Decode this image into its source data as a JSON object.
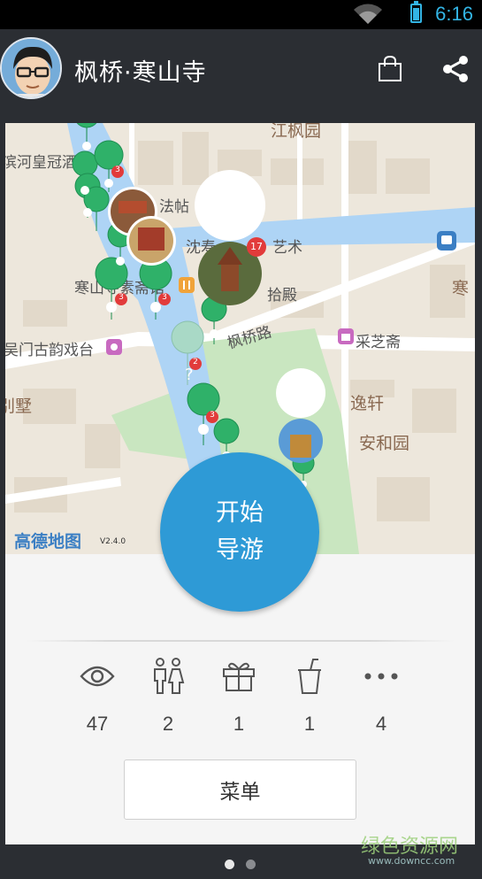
{
  "status": {
    "time": "6:16"
  },
  "appbar": {
    "title": "枫桥·寒山寺"
  },
  "map": {
    "labels": {
      "binhe_hotel": "滨河皇冠酒店",
      "jiangfengyuan": "江枫园",
      "fatie": "法帖",
      "shenshou": "沈寿",
      "yishu": "艺术",
      "hanshan_vegetarian": "寒山寺素斋馆",
      "shidian": "拾殿",
      "fengqiao_road": "枫桥路",
      "wumen_theater": "吴门古韵戏台",
      "caizhizhai": "采芝斋",
      "villa": "别墅",
      "yixuan": "逸轩",
      "anheyuan": "安和园",
      "han": "寒"
    },
    "pins": [
      {
        "count": "3"
      },
      {
        "count": "17"
      },
      {
        "count": "3"
      },
      {
        "count": "3"
      },
      {
        "count": "2"
      },
      {
        "count": "3"
      }
    ],
    "logo": "高德地图",
    "version": "V2.4.0",
    "colors": {
      "water": "#aed4f5",
      "park": "#c9e6c0",
      "pin": "#2fb169",
      "badge": "#e23b3b"
    }
  },
  "start_button": {
    "line1": "开始",
    "line2": "导游"
  },
  "stats": [
    {
      "icon": "eye-icon",
      "value": "47"
    },
    {
      "icon": "toilet-icon",
      "value": "2"
    },
    {
      "icon": "gift-icon",
      "value": "1"
    },
    {
      "icon": "drink-icon",
      "value": "1"
    },
    {
      "icon": "more-icon",
      "value": "4"
    }
  ],
  "menu_button": {
    "label": "菜单"
  },
  "watermark": {
    "text": "绿色资源网",
    "url": "www.downcc.com"
  },
  "pager": {
    "count": 2,
    "active": 0
  }
}
